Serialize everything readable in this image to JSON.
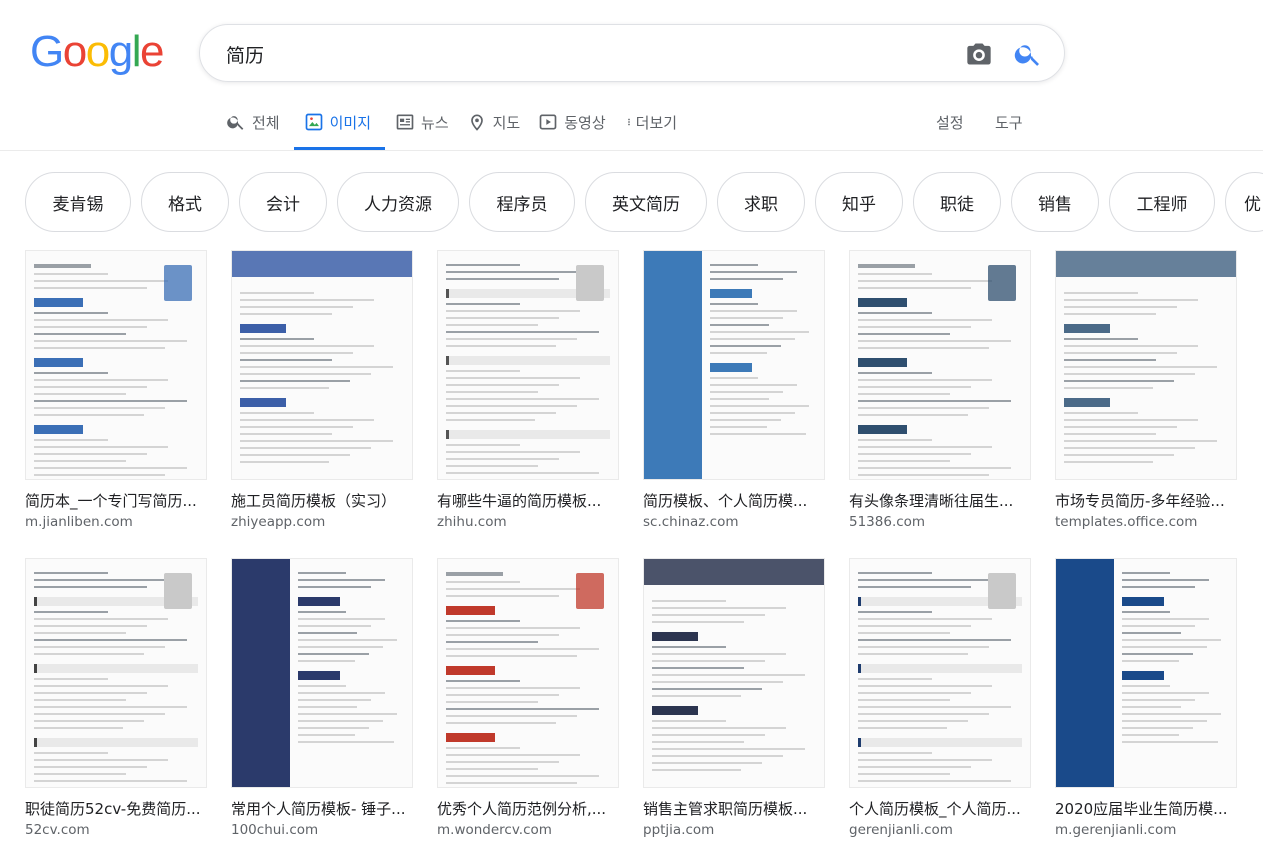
{
  "search": {
    "query": "简历"
  },
  "tabs": [
    {
      "label": "전체",
      "icon": "search-icon",
      "active": false
    },
    {
      "label": "이미지",
      "icon": "image-icon",
      "active": true
    },
    {
      "label": "뉴스",
      "icon": "news-icon",
      "active": false
    },
    {
      "label": "지도",
      "icon": "map-pin-icon",
      "active": false
    },
    {
      "label": "동영상",
      "icon": "video-icon",
      "active": false
    },
    {
      "label": "더보기",
      "icon": "more-vert-icon",
      "active": false
    }
  ],
  "tools": {
    "settings": "설정",
    "tools": "도구"
  },
  "chips": [
    "麦肯锡",
    "格式",
    "会计",
    "人力资源",
    "程序员",
    "英文简历",
    "求职",
    "知乎",
    "职徒",
    "销售",
    "工程师",
    "优"
  ],
  "results": [
    {
      "title": "简历本_一个专门写简历...",
      "site": "m.jianliben.com",
      "accent": "#3b6fb6"
    },
    {
      "title": "施工员简历模板（实习）",
      "site": "zhiyeapp.com",
      "accent": "#3c5fa8"
    },
    {
      "title": "有哪些牛逼的简历模板...",
      "site": "zhihu.com",
      "accent": "#555555"
    },
    {
      "title": "简历模板、个人简历模...",
      "site": "sc.chinaz.com",
      "accent": "#3d7ab8"
    },
    {
      "title": "有头像条理清晰往届生...",
      "site": "51386.com",
      "accent": "#2f4f6f"
    },
    {
      "title": "市场专员简历-多年经验...",
      "site": "templates.office.com",
      "accent": "#4b6a88"
    },
    {
      "title": "职徒简历52cv-免费简历...",
      "site": "52cv.com",
      "accent": "#444444"
    },
    {
      "title": "常用个人简历模板- 锤子...",
      "site": "100chui.com",
      "accent": "#2b3a6b"
    },
    {
      "title": "优秀个人简历范例分析,...",
      "site": "m.wondercv.com",
      "accent": "#c0392b"
    },
    {
      "title": "销售主管求职简历模板...",
      "site": "pptjia.com",
      "accent": "#2c3550"
    },
    {
      "title": "个人简历模板_个人简历...",
      "site": "gerenjianli.com",
      "accent": "#1e3c6e"
    },
    {
      "title": "2020应届毕业生简历模...",
      "site": "m.gerenjianli.com",
      "accent": "#1a4a8a"
    }
  ]
}
